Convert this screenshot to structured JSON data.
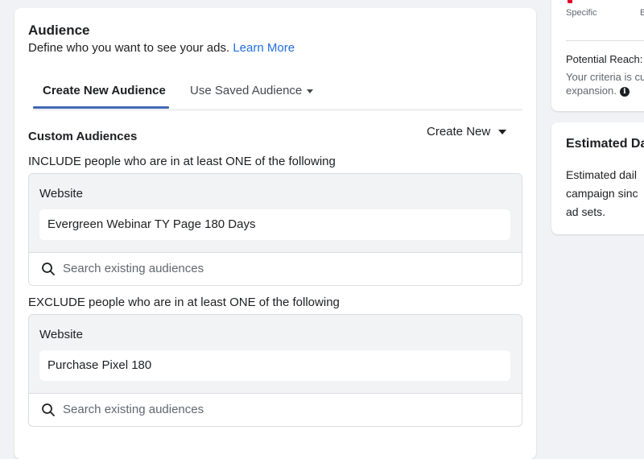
{
  "audience": {
    "title": "Audience",
    "subtitle": "Define who you want to see your ads.",
    "learn_more": "Learn More",
    "tabs": [
      {
        "label": "Create New Audience"
      },
      {
        "label": "Use Saved Audience"
      }
    ],
    "custom_audiences": {
      "title": "Custom Audiences",
      "create_new": "Create New"
    },
    "include": {
      "rule": "INCLUDE people who are in at least ONE of the following",
      "group_label": "Website",
      "item": "Evergreen Webinar TY Page 180 Days",
      "search_placeholder": "Search existing audiences"
    },
    "exclude": {
      "rule": "EXCLUDE people who are in at least ONE of the following",
      "group_label": "Website",
      "item": "Purchase Pixel 180",
      "search_placeholder": "Search existing audiences"
    }
  },
  "right_panel": {
    "specific_label": "Specific",
    "broad_label": "B",
    "potential_reach": "Potential Reach:",
    "criteria_line1": "Your criteria is cu",
    "criteria_line2": "expansion.",
    "estimated_title": "Estimated Da",
    "estimated_line1": "Estimated dail",
    "estimated_line2": "campaign sinc",
    "estimated_line3": "ad sets."
  },
  "colors": {
    "link": "#216fdb",
    "tab_underline": "#4267b2",
    "page_bg": "#f0f2f5",
    "gauge_red": "#e4002b"
  }
}
